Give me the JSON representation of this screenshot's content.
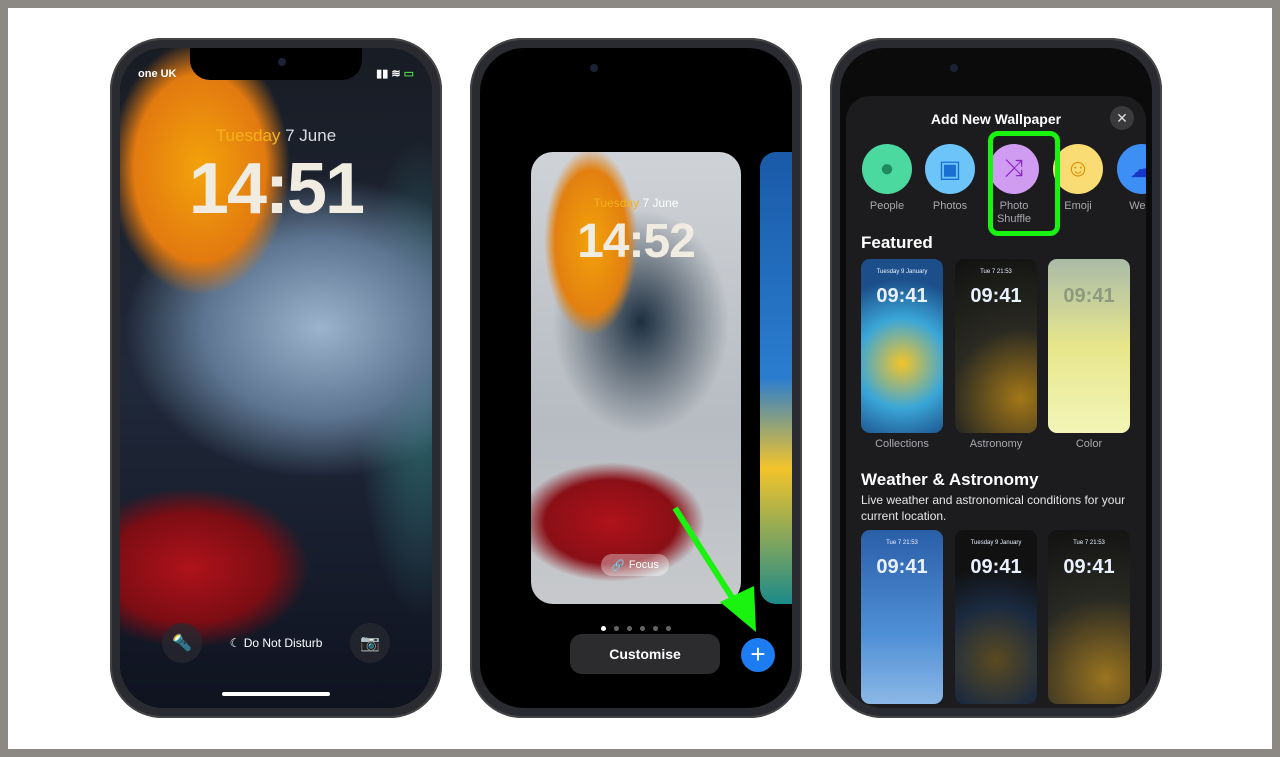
{
  "phone1": {
    "carrier": "one UK",
    "date_day": "Tuesday",
    "date_rest": " 7 June",
    "time": "14:51",
    "dnd_label": "Do Not Disturb",
    "icons": [
      "flashlight-icon",
      "moon-icon",
      "camera-icon"
    ]
  },
  "phone2": {
    "date_day": "Tuesday",
    "date_rest": " 7 June",
    "time": "14:52",
    "focus_label": "Focus",
    "page_count": 6,
    "active_page": 1,
    "customise_label": "Customise",
    "add_label": "+"
  },
  "phone3": {
    "title": "Add New Wallpaper",
    "close": "✕",
    "options": [
      {
        "label": "People",
        "color": "#4cd9a0"
      },
      {
        "label": "Photos",
        "color": "#6cc4f8"
      },
      {
        "label": "Photo Shuffle",
        "color": "#cf9cf2"
      },
      {
        "label": "Emoji",
        "color": "#f9dc74"
      },
      {
        "label": "Weat",
        "color": "#3d8ff5"
      }
    ],
    "featured_title": "Featured",
    "featured": [
      {
        "time": "09:41",
        "date": "Tuesday 9 January",
        "label": "Collections"
      },
      {
        "time": "09:41",
        "date": "Tue 7  21:53",
        "label": "Astronomy"
      },
      {
        "time": "09:41",
        "date": "",
        "label": "Color"
      }
    ],
    "weather_title": "Weather & Astronomy",
    "weather_sub": "Live weather and astronomical conditions for your current location.",
    "weather": [
      {
        "time": "09:41",
        "date": "Tue 7  21:53"
      },
      {
        "time": "09:41",
        "date": "Tuesday 9 January"
      },
      {
        "time": "09:41",
        "date": "Tue 7  21:53"
      }
    ]
  },
  "colors": {
    "highlight": "#19f30f",
    "arrow": "#19f30f",
    "accent": "#1e7cf2"
  }
}
